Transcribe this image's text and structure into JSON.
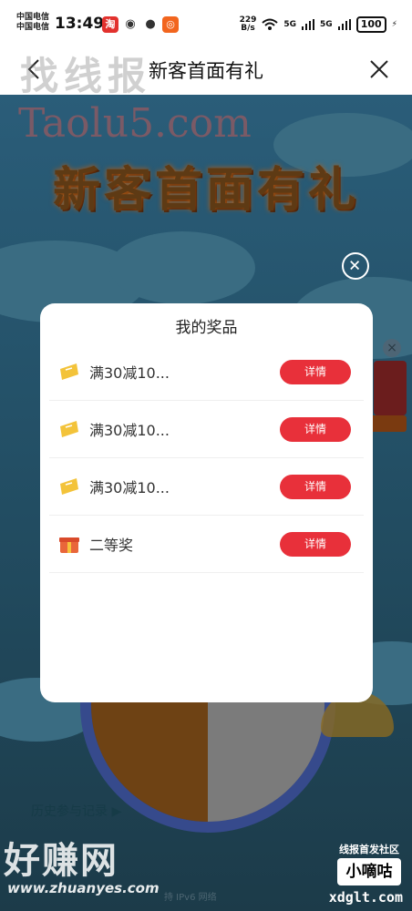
{
  "status_bar": {
    "carrier_1": "中国电信",
    "carrier_2": "中国电信",
    "time": "13:49",
    "net_speed_value": "229",
    "net_speed_unit": "B/s",
    "signal_1": "5G",
    "signal_2": "5G",
    "battery": "100"
  },
  "nav": {
    "title": "新客首面有礼",
    "back_icon": "chevron-left-icon",
    "close_icon": "close-icon"
  },
  "page": {
    "hero_title": "新客首面有礼",
    "history_link": "历史参与记录 ▶",
    "ipv6_text": "持 IPv6 网络"
  },
  "watermarks": {
    "top": "找线报",
    "site": "Taolu5.com",
    "bottom": "好赚网",
    "bottom_url": "www.zhuanyes.com",
    "badge_tag": "线报首发社区",
    "badge": "小嘀咕",
    "badge_url": "xdglt.com"
  },
  "modal": {
    "title": "我的奖品",
    "close_icon": "close-circle-icon",
    "prizes": [
      {
        "icon": "coupon-icon",
        "name": "满30减10...",
        "button": "详情"
      },
      {
        "icon": "coupon-icon",
        "name": "满30减10...",
        "button": "详情"
      },
      {
        "icon": "coupon-icon",
        "name": "满30减10...",
        "button": "详情"
      },
      {
        "icon": "gift-icon",
        "name": "二等奖",
        "button": "详情"
      }
    ]
  },
  "colors": {
    "accent": "#e8303a",
    "overlay": "#1f3a48"
  }
}
